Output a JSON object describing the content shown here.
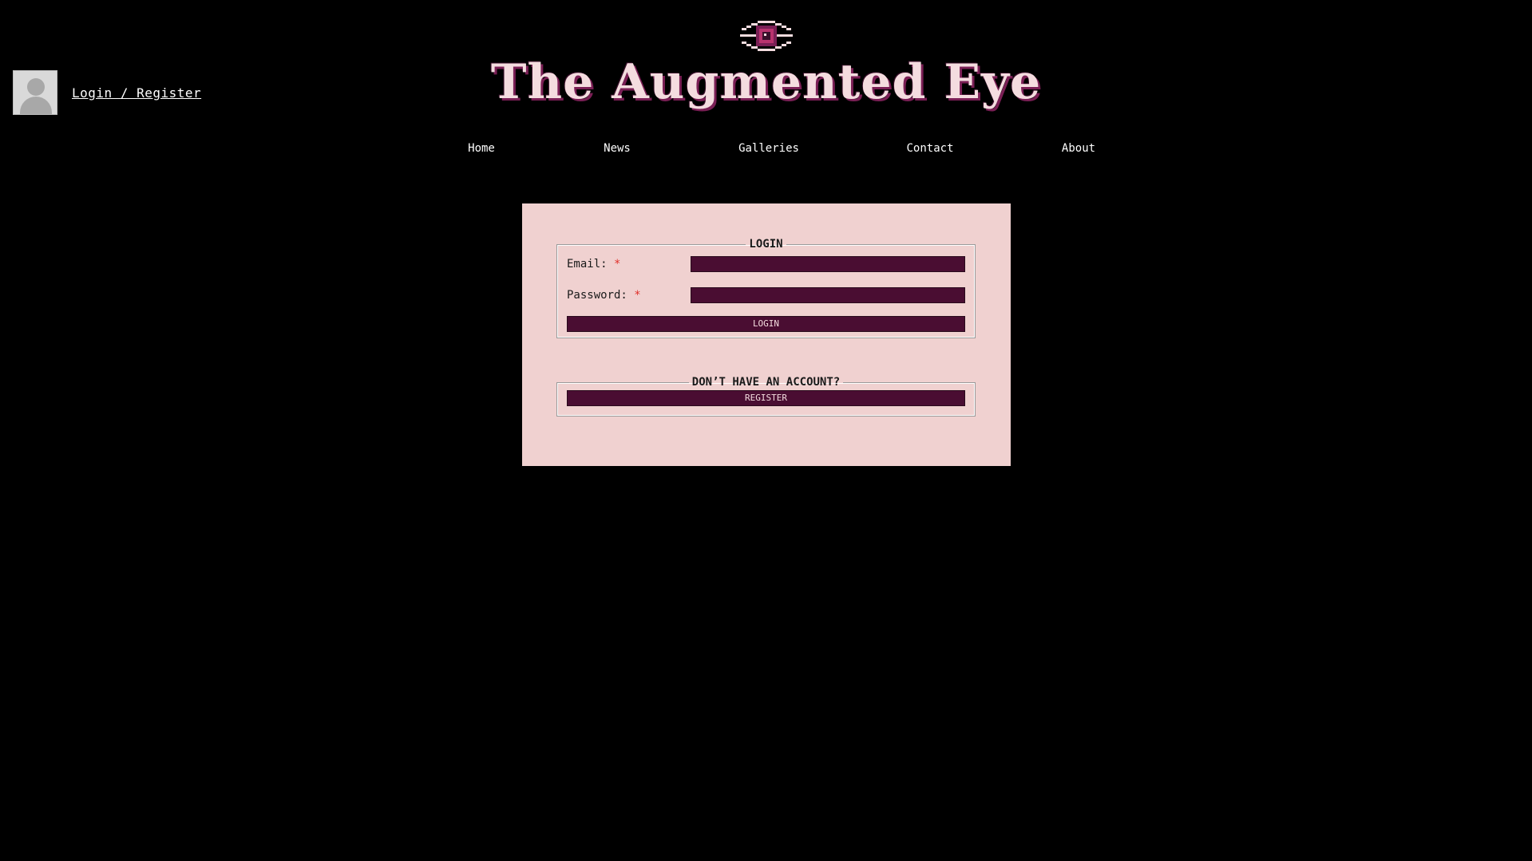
{
  "user": {
    "login_link": "Login / Register"
  },
  "site": {
    "title": "The Augmented Eye",
    "logo_icon": "eye-icon"
  },
  "nav": {
    "items": [
      {
        "label": "Home"
      },
      {
        "label": "News"
      },
      {
        "label": "Galleries"
      },
      {
        "label": "Contact"
      },
      {
        "label": "About"
      }
    ]
  },
  "login_form": {
    "legend": "LOGIN",
    "email_label": "Email:",
    "password_label": "Password:",
    "required_mark": "*",
    "email_value": "",
    "password_value": "",
    "submit_label": "LOGIN"
  },
  "register": {
    "legend": "DON’T HAVE AN ACCOUNT?",
    "button_label": "REGISTER"
  },
  "colors": {
    "background": "#000000",
    "panel": "#f0d1d0",
    "accent": "#4a0d32",
    "title": "#f4dcdf",
    "required": "#e0302a"
  }
}
